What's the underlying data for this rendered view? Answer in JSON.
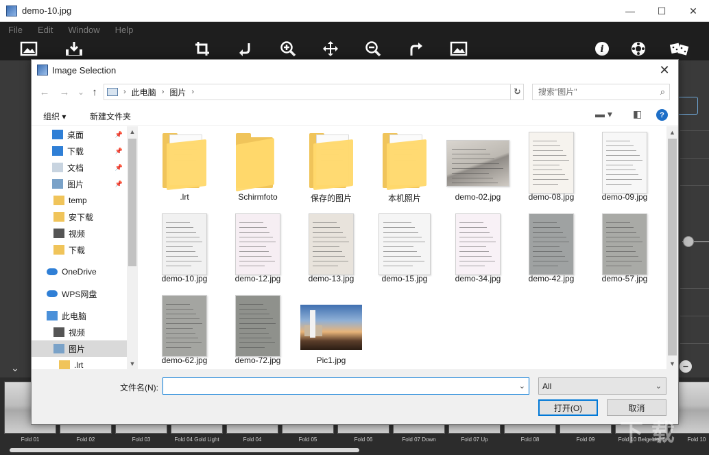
{
  "window": {
    "title": "demo-10.jpg",
    "controls": {
      "minimize": "—",
      "maximize": "☐",
      "close": "✕"
    }
  },
  "menubar": {
    "items": [
      "File",
      "Edit",
      "Window",
      "Help"
    ]
  },
  "toolbar": {
    "icons": [
      "open-image-icon",
      "save-image-icon",
      "crop-icon",
      "rotate-left-icon",
      "zoom-in-icon",
      "move-icon",
      "zoom-out-icon",
      "rotate-right-icon",
      "fit-screen-icon",
      "info-icon",
      "settings-icon",
      "random-icon"
    ]
  },
  "filmstrip": {
    "items": [
      {
        "label": "Fold 01"
      },
      {
        "label": "Fold 02"
      },
      {
        "label": "Fold 03"
      },
      {
        "label": "Fold 04 Gold Light"
      },
      {
        "label": "Fold 04"
      },
      {
        "label": "Fold 05"
      },
      {
        "label": "Fold 06"
      },
      {
        "label": "Fold 07 Down"
      },
      {
        "label": "Fold 07 Up"
      },
      {
        "label": "Fold 08"
      },
      {
        "label": "Fold 09"
      },
      {
        "label": "Fold 10 BeigeLight"
      },
      {
        "label": "Fold 10"
      }
    ]
  },
  "dialog": {
    "title": "Image Selection",
    "close": "✕",
    "nav": {
      "back": "←",
      "forward": "→",
      "recent": "⌄",
      "up": "↑"
    },
    "address": {
      "crumbs": [
        "此电脑",
        "图片"
      ],
      "separator": "›",
      "refresh": "↻"
    },
    "search": {
      "placeholder": "搜索\"图片\""
    },
    "commands": {
      "organize": "组织 ▾",
      "new_folder": "新建文件夹",
      "help": "?"
    },
    "nav_pane": {
      "items": [
        {
          "label": "桌面",
          "icon": "desktop-icon",
          "pinned": true
        },
        {
          "label": "下载",
          "icon": "download-icon",
          "pinned": true
        },
        {
          "label": "文档",
          "icon": "document-icon",
          "pinned": true
        },
        {
          "label": "图片",
          "icon": "pictures-icon",
          "pinned": true
        },
        {
          "label": "temp",
          "icon": "folder-icon",
          "pinned": false
        },
        {
          "label": "安下载",
          "icon": "folder-icon",
          "pinned": false
        },
        {
          "label": "视频",
          "icon": "video-icon",
          "pinned": false
        },
        {
          "label": "下载",
          "icon": "folder-icon",
          "pinned": false
        },
        {
          "label": "OneDrive",
          "icon": "cloud-icon",
          "pinned": false
        },
        {
          "label": "WPS网盘",
          "icon": "cloud-icon",
          "pinned": false
        },
        {
          "label": "此电脑",
          "icon": "computer-icon",
          "pinned": false
        },
        {
          "label": "视频",
          "icon": "video-icon",
          "pinned": false
        },
        {
          "label": "图片",
          "icon": "pictures-icon",
          "pinned": false,
          "selected": true
        },
        {
          "label": ".lrt",
          "icon": "folder-icon",
          "pinned": false
        }
      ]
    },
    "files": [
      {
        "name": ".lrt",
        "type": "folder"
      },
      {
        "name": "Schirmfoto",
        "type": "folder-empty"
      },
      {
        "name": "保存的图片",
        "type": "folder"
      },
      {
        "name": "本机照片",
        "type": "folder"
      },
      {
        "name": "demo-02.jpg",
        "type": "doc-wide"
      },
      {
        "name": "demo-08.jpg",
        "type": "doc"
      },
      {
        "name": "demo-09.jpg",
        "type": "doc"
      },
      {
        "name": "demo-10.jpg",
        "type": "doc"
      },
      {
        "name": "demo-12.jpg",
        "type": "doc"
      },
      {
        "name": "demo-13.jpg",
        "type": "doc"
      },
      {
        "name": "demo-15.jpg",
        "type": "doc"
      },
      {
        "name": "demo-34.jpg",
        "type": "doc"
      },
      {
        "name": "demo-42.jpg",
        "type": "doc"
      },
      {
        "name": "demo-57.jpg",
        "type": "doc"
      },
      {
        "name": "demo-62.jpg",
        "type": "doc"
      },
      {
        "name": "demo-72.jpg",
        "type": "doc"
      },
      {
        "name": "Pic1.jpg",
        "type": "photo"
      }
    ],
    "filename": {
      "label": "文件名(N):",
      "value": ""
    },
    "filter": {
      "value": "All"
    },
    "buttons": {
      "open": "打开(O)",
      "cancel": "取消"
    }
  }
}
